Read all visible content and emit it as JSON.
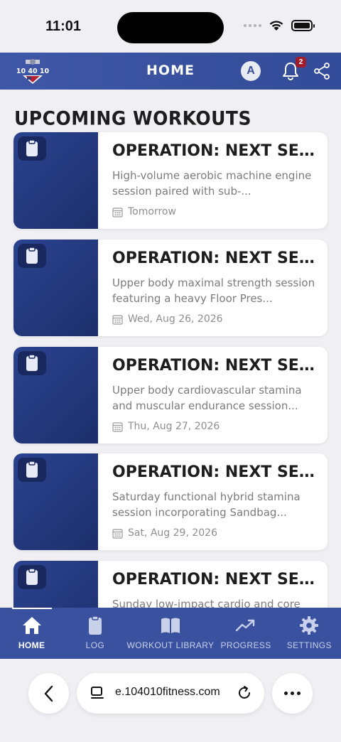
{
  "status_bar": {
    "time": "11:01"
  },
  "header": {
    "title": "HOME",
    "avatar_initial": "A",
    "notification_count": "2",
    "logo_text": "10 40 10"
  },
  "section": {
    "title": "UPCOMING WORKOUTS"
  },
  "workouts": [
    {
      "title": "OPERATION: NEXT SEMESTER...",
      "description": "High-volume aerobic machine engine session paired with sub-...",
      "date": "Tomorrow"
    },
    {
      "title": "OPERATION: NEXT SEMESTER...",
      "description": "Upper body maximal strength session featuring a heavy Floor Pres...",
      "date": "Wed, Aug 26, 2026"
    },
    {
      "title": "OPERATION: NEXT SEMESTER...",
      "description": "Upper body cardiovascular stamina and muscular endurance session...",
      "date": "Thu, Aug 27, 2026"
    },
    {
      "title": "OPERATION: NEXT SEMESTER...",
      "description": "Saturday functional hybrid stamina session incorporating Sandbag...",
      "date": "Sat, Aug 29, 2026"
    },
    {
      "title": "OPERATION: NEXT SEMESTER...",
      "description": "Sunday low-impact cardio and core",
      "date": ""
    }
  ],
  "nav": {
    "items": [
      {
        "label": "HOME",
        "icon": "home-icon",
        "active": true
      },
      {
        "label": "LOG",
        "icon": "clipboard-icon",
        "active": false
      },
      {
        "label": "WORKOUT LIBRARY",
        "icon": "book-icon",
        "active": false
      },
      {
        "label": "PROGRESS",
        "icon": "trend-icon",
        "active": false
      },
      {
        "label": "SETTINGS",
        "icon": "gear-icon",
        "active": false
      }
    ]
  },
  "browser": {
    "url": "e.104010fitness.com"
  },
  "colors": {
    "brand_blue": "#3a519f",
    "card_blue": "#2a4390",
    "badge_red": "#a01d2b"
  }
}
